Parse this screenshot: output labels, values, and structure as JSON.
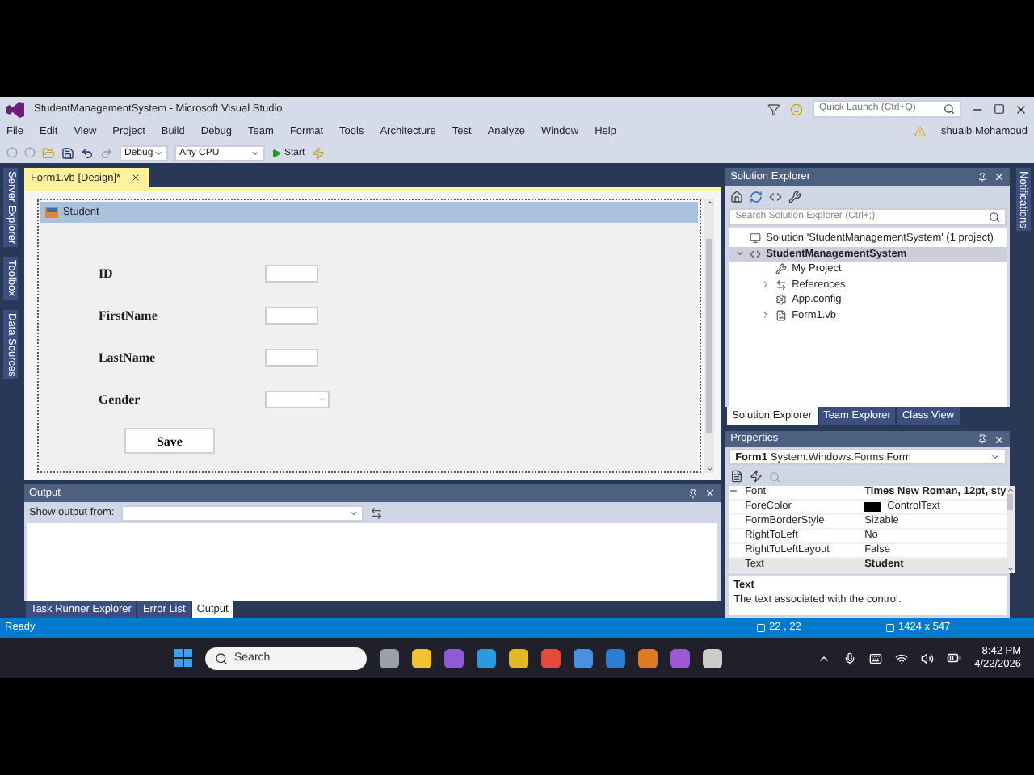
{
  "window": {
    "title": "StudentManagementSystem - Microsoft Visual Studio",
    "quick_launch": {
      "placeholder": "Quick Launch (Ctrl+Q)"
    },
    "user": "shuaib Mohamoud"
  },
  "menu": [
    "File",
    "Edit",
    "View",
    "Project",
    "Build",
    "Debug",
    "Team",
    "Format",
    "Tools",
    "Architecture",
    "Test",
    "Analyze",
    "Window",
    "Help"
  ],
  "toolbar": {
    "configuration": "Debug",
    "platform": "Any CPU",
    "start": "Start"
  },
  "left_tabs": [
    "Server Explorer",
    "Toolbox",
    "Data Sources"
  ],
  "right_tabs": [
    "Notifications"
  ],
  "document_tabs": [
    {
      "label": "Form1.vb [Design]*",
      "selected": true
    }
  ],
  "form": {
    "title": "Student",
    "fields": [
      {
        "label": "ID",
        "kind": "text"
      },
      {
        "label": "FirstName",
        "kind": "text"
      },
      {
        "label": "LastName",
        "kind": "text"
      },
      {
        "label": "Gender",
        "kind": "combo"
      }
    ],
    "button": "Save"
  },
  "output": {
    "title": "Output",
    "show_from_label": "Show output from:",
    "tabs": [
      {
        "label": "Task Runner Explorer",
        "selected": false
      },
      {
        "label": "Error List",
        "selected": false
      },
      {
        "label": "Output",
        "selected": true
      }
    ]
  },
  "solution_explorer": {
    "title": "Solution Explorer",
    "search": {
      "placeholder": "Search Solution Explorer (Ctrl+;)"
    },
    "tree": [
      {
        "label": "Solution 'StudentManagementSystem' (1 project)",
        "kind": "solution",
        "expandable": false,
        "selected": false,
        "children": [
          {
            "label": "StudentManagementSystem",
            "kind": "project",
            "expandable": true,
            "expanded": true,
            "selected": true,
            "children": [
              {
                "label": "My Project",
                "kind": "wrench",
                "expandable": false,
                "selected": false
              },
              {
                "label": "References",
                "kind": "references",
                "expandable": true,
                "expanded": false,
                "selected": false
              },
              {
                "label": "App.config",
                "kind": "config",
                "expandable": false,
                "selected": false
              },
              {
                "label": "Form1.vb",
                "kind": "form",
                "expandable": true,
                "expanded": false,
                "selected": false
              }
            ]
          }
        ]
      }
    ],
    "tabs": [
      {
        "label": "Solution Explorer",
        "selected": true
      },
      {
        "label": "Team Explorer",
        "selected": false
      },
      {
        "label": "Class View",
        "selected": false
      }
    ]
  },
  "properties": {
    "title": "Properties",
    "object": "Form1",
    "object_type": "System.Windows.Forms.Form",
    "rows": [
      {
        "name": "Font",
        "value": "Times New Roman, 12pt, sty",
        "bold": true,
        "selected": false,
        "group": true
      },
      {
        "name": "ForeColor",
        "value": "ControlText",
        "bold": false,
        "selected": false,
        "color": "#000000"
      },
      {
        "name": "FormBorderStyle",
        "value": "Sizable",
        "bold": false,
        "selected": false
      },
      {
        "name": "RightToLeft",
        "value": "No",
        "bold": false,
        "selected": false
      },
      {
        "name": "RightToLeftLayout",
        "value": "False",
        "bold": false,
        "selected": false
      },
      {
        "name": "Text",
        "value": "Student",
        "bold": true,
        "selected": true
      }
    ],
    "description": {
      "title": "Text",
      "text": "The text associated with the control."
    }
  },
  "status_bar": {
    "state": "Ready",
    "position": "22 , 22",
    "size": "1424 x 547"
  },
  "taskbar": {
    "search": {
      "placeholder": "Search"
    },
    "time": "8:42 PM",
    "date": "4/22/2026"
  }
}
